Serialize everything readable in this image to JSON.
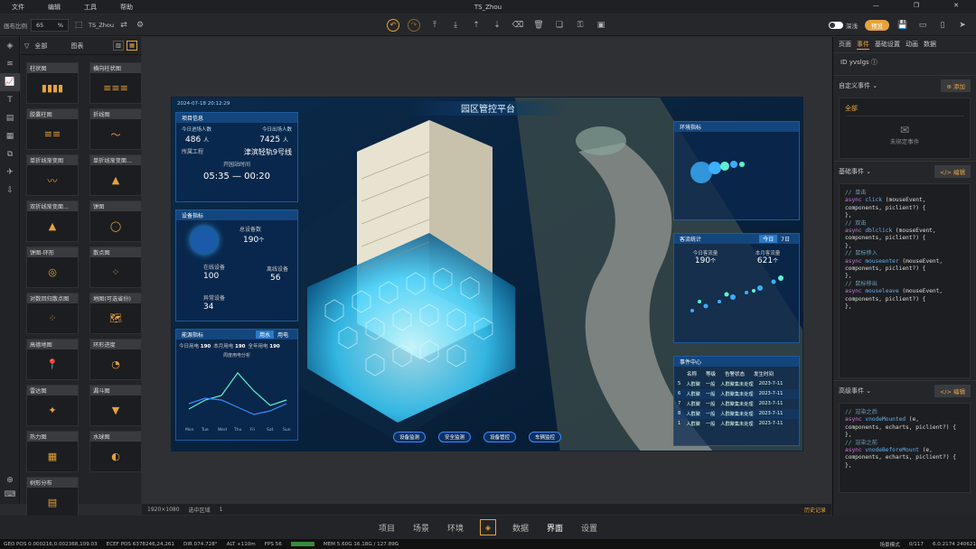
{
  "menubar": {
    "items": [
      "文件",
      "编辑",
      "工具",
      "帮助"
    ],
    "title": "TS_Zhou"
  },
  "toolbar": {
    "ratio_label": "画布比例",
    "ratio_value": "65",
    "ratio_unit": "%",
    "project": "TS_Zhou",
    "theme_label": "深浅",
    "tag_label": "预览"
  },
  "left_panel": {
    "filter": "全部",
    "tab": "图表",
    "items": [
      "柱状图",
      "横向柱状图",
      "胶囊柱图",
      "折线图",
      "单折线渐变图",
      "单折线渐变面...",
      "双折线渐变面...",
      "饼图",
      "饼图-环形",
      "散点图",
      "对数回归散点图",
      "地图(可选省份)",
      "高德地图",
      "环形进度",
      "雷达图",
      "漏斗图",
      "热力图",
      "水球图",
      "树形分布"
    ]
  },
  "dashboard": {
    "title": "园区管控平台",
    "datetime": "2024-07-18 20:12:29",
    "project_info": "项目信息",
    "today_in": "今日进场人数",
    "today_in_val": "486",
    "today_in_unit": "人",
    "today_out": "今日出场人数",
    "today_out_val": "7425",
    "today_out_unit": "人",
    "status_label": "所属工程",
    "status_val": "津滨轻轨9号线",
    "open_time_label": "开园站时间",
    "time_from": "05:35",
    "time_to": "00:20",
    "device_label": "设备指标",
    "total_devices_label": "总设备数",
    "total_devices": "190",
    "total_devices_unit": "个",
    "online_label": "在线设备",
    "online_val": "100",
    "offline_label": "离线设备",
    "offline_val": "56",
    "abnormal_label": "异常设备",
    "abnormal_val": "34",
    "energy_label": "能源指标",
    "energy_tab1": "用水",
    "energy_tab2": "用电",
    "today_label": "今日用电",
    "today_val": "190",
    "month_label": "本月用电",
    "month_val": "190",
    "year_label": "全年用电",
    "year_val": "190",
    "chart_title": "周度用电分析",
    "days": [
      "Mon",
      "Tue",
      "Wed",
      "Thu",
      "Fri",
      "Sat",
      "Sun"
    ],
    "env_label": "环境指标",
    "flow_label": "客流统计",
    "flow_today": "今日",
    "flow_7": "7日",
    "flow_today_label": "今日客流量",
    "flow_today_val": "190",
    "flow_today_unit": "个",
    "flow_month_label": "本月客流量",
    "flow_month_val": "621",
    "flow_month_unit": "个",
    "event_label": "事件中心",
    "event_cols": [
      "名称",
      "等级",
      "告警状态",
      "发生时间"
    ],
    "event_rows": [
      {
        "n": "5",
        "name": "人群聚",
        "lvl": "一般",
        "state": "人群聚集未处理",
        "time": "2023-7-11"
      },
      {
        "n": "6",
        "name": "人群聚",
        "lvl": "一般",
        "state": "人群聚集未处理",
        "time": "2023-7-11"
      },
      {
        "n": "7",
        "name": "人群聚",
        "lvl": "一般",
        "state": "人群聚集未处理",
        "time": "2023-7-11"
      },
      {
        "n": "8",
        "name": "人群聚",
        "lvl": "一般",
        "state": "人群聚集未处理",
        "time": "2023-7-11"
      },
      {
        "n": "1",
        "name": "人群聚",
        "lvl": "一般",
        "state": "人群聚集未处理",
        "time": "2023-7-11"
      }
    ],
    "bottom_btns": [
      "设备监测",
      "安全监测",
      "设备管控",
      "车辆监控"
    ]
  },
  "status": {
    "size": "1920×1080",
    "select": "选中区域",
    "count": "1",
    "history": "历史记录"
  },
  "bottom_nav": [
    "项目",
    "场景",
    "环境",
    "数据",
    "界面",
    "设置"
  ],
  "geo": {
    "geo": "GEO POS 0.000216,0.002368,109.03",
    "ecef": "ECEF POS 6378246,24,261",
    "dir": "DIR 074.728°",
    "alt": "ALT +110m",
    "fps": "FPS 56",
    "mem": "MEM 5.60G 16.18G / 127.89G",
    "mode": "场景模式",
    "count": "0/117",
    "ver": "6.0.2174 240621"
  },
  "right_panel": {
    "tabs": [
      "页面",
      "事件",
      "基础设置",
      "动画",
      "数据"
    ],
    "id_label": "ID",
    "id_val": "yvslgs",
    "custom_events": "自定义事件",
    "add": "添加",
    "all": "全部",
    "unbound": "未绑定事件",
    "basic_events": "基础事件",
    "edit": "编辑",
    "advanced_events": "高级事件"
  }
}
